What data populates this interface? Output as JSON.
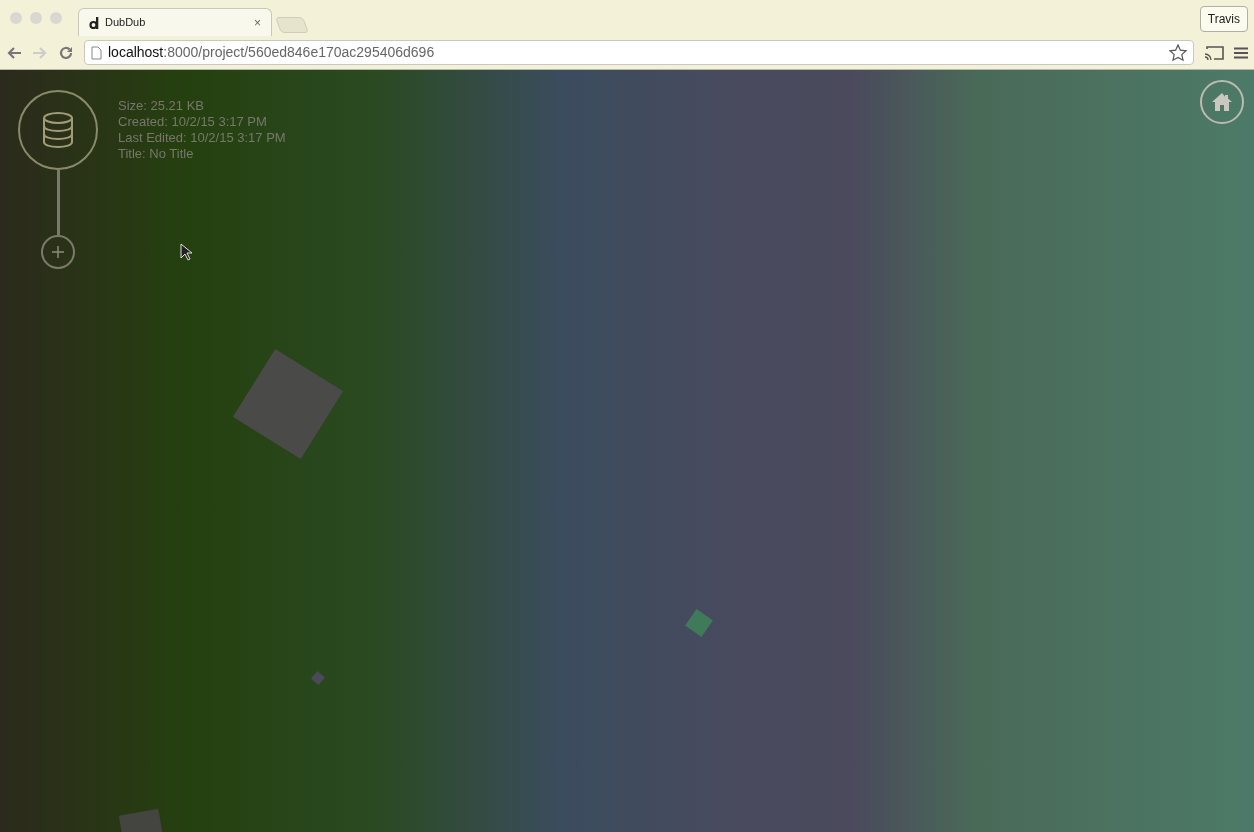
{
  "browser": {
    "tab": {
      "title": "DubDub",
      "selected": true,
      "close": "×"
    },
    "profile": "Travis",
    "address": {
      "host": "localhost",
      "path": ":8000/project/560ed846e170ac295406d696"
    }
  },
  "project": {
    "info": [
      "Size: 25.21 KB",
      "Created: 10/2/15 3:17 PM",
      "Last Edited: 10/2/15 3:17 PM",
      "Title: No Title"
    ]
  }
}
